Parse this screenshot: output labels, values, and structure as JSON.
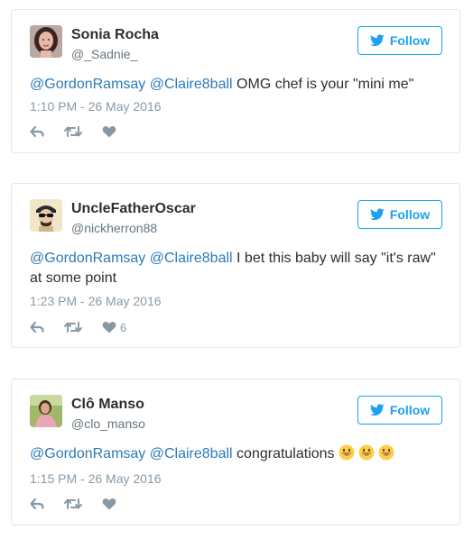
{
  "follow_label": "Follow",
  "colors": {
    "link": "#2b7bb9",
    "follow": "#1da1f2",
    "icon": "#8899a6"
  },
  "tweets": [
    {
      "name": "Sonia Rocha",
      "handle": "@_Sadnie_",
      "mention1": "@GordonRamsay",
      "mention2": "@Claire8ball",
      "text": " OMG chef is your \"mini me\"",
      "time": "1:10 PM - 26 May 2016",
      "likes": "",
      "avatar_icon": "woman-portrait-avatar"
    },
    {
      "name": "UncleFatherOscar",
      "handle": "@nickherron88",
      "mention1": "@GordonRamsay",
      "mention2": "@Claire8ball",
      "text": " I bet this baby will say \"it's raw\" at some point",
      "time": "1:23 PM - 26 May 2016",
      "likes": "6",
      "avatar_icon": "man-sunglasses-avatar"
    },
    {
      "name": "Clô Manso",
      "handle": "@clo_manso",
      "mention1": "@GordonRamsay",
      "mention2": "@Claire8ball",
      "text": " congratulations",
      "time": "1:15 PM - 26 May 2016",
      "likes": "",
      "emoji": [
        "grinning-face-emoji",
        "grinning-face-emoji",
        "grinning-face-emoji"
      ],
      "avatar_icon": "woman-outdoor-avatar"
    }
  ]
}
